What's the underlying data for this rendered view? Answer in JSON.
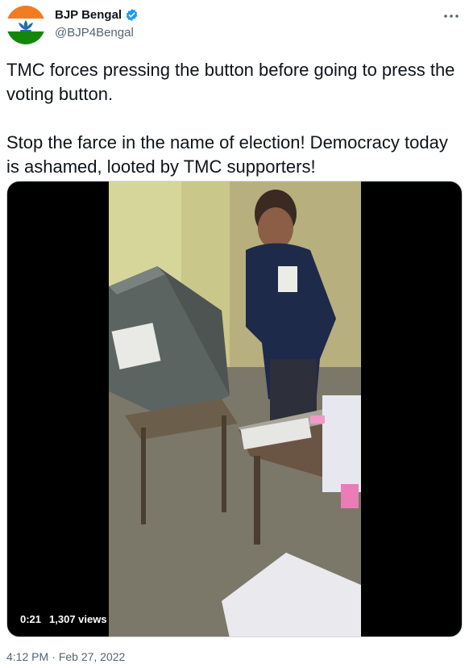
{
  "author": {
    "display_name": "BJP Bengal",
    "handle": "@BJP4Bengal",
    "verified": true,
    "avatar_icon": "india-flag-lotus-avatar-icon"
  },
  "tweet": {
    "paragraphs": [
      "TMC forces pressing the button before going to press the voting button.",
      "Stop the farce in the name of election! Democracy today is ashamed, looted by TMC supporters!"
    ]
  },
  "video": {
    "duration": "0:21",
    "views": "1,307 views"
  },
  "meta": {
    "time": "4:12 PM",
    "separator": "·",
    "date": "Feb 27, 2022"
  },
  "colors": {
    "text": "#0f1419",
    "secondary": "#536471",
    "verified": "#1d9bf0",
    "saffron": "#f47c20",
    "green": "#138808"
  }
}
